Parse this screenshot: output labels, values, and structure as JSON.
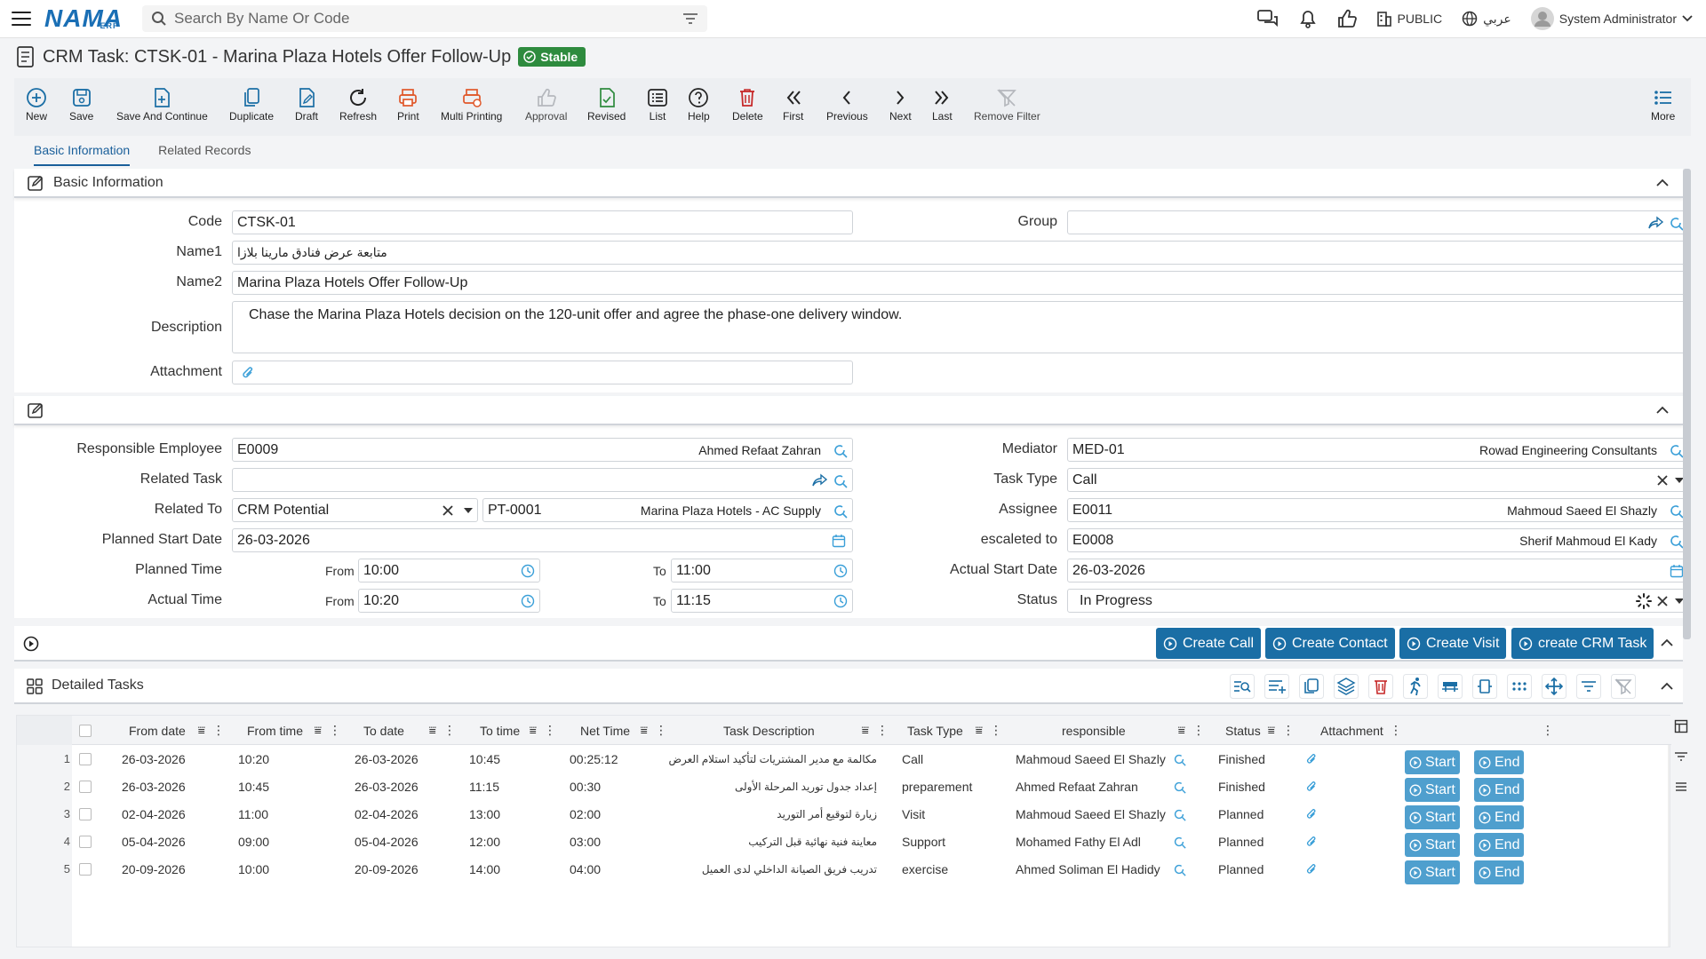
{
  "topbar": {
    "search_placeholder": "Search By Name Or Code",
    "public_label": "PUBLIC",
    "language_label": "عربي",
    "user_name": "System Administrator"
  },
  "logo": {
    "text": "NAMA",
    "sub": "ERP"
  },
  "page": {
    "title": "CRM Task: CTSK-01 - Marina Plaza Hotels Offer Follow-Up",
    "status_badge": "Stable"
  },
  "toolbar": {
    "new": "New",
    "save": "Save",
    "save_continue": "Save And Continue",
    "duplicate": "Duplicate",
    "draft": "Draft",
    "refresh": "Refresh",
    "print": "Print",
    "multi_printing": "Multi Printing",
    "approval": "Approval",
    "revised": "Revised",
    "list": "List",
    "help": "Help",
    "delete": "Delete",
    "first": "First",
    "previous": "Previous",
    "next": "Next",
    "last": "Last",
    "remove_filter": "Remove Filter",
    "more": "More"
  },
  "tabs": {
    "basic": "Basic Information",
    "related": "Related Records"
  },
  "basic_section": {
    "title": "Basic Information",
    "code_label": "Code",
    "code_value": "CTSK-01",
    "group_label": "Group",
    "group_value": "",
    "name1_label": "Name1",
    "name1_value": "متابعة عرض فنادق مارينا بلازا",
    "name2_label": "Name2",
    "name2_value": "Marina Plaza Hotels Offer Follow-Up",
    "description_label": "Description",
    "description_value": "Chase the Marina Plaza Hotels decision on the 120-unit offer and agree the phase-one delivery window.",
    "attachment_label": "Attachment"
  },
  "detail_section": {
    "responsible_label": "Responsible Employee",
    "responsible_code": "E0009",
    "responsible_name": "Ahmed Refaat Zahran",
    "related_task_label": "Related Task",
    "related_task_value": "",
    "related_to_label": "Related To",
    "related_to_value": "CRM Potential",
    "related_to_code": "PT-0001",
    "related_to_name": "Marina Plaza Hotels - AC Supply",
    "planned_start_label": "Planned Start Date",
    "planned_start_value": "26-03-2026",
    "planned_time_label": "Planned Time",
    "from_label": "From",
    "to_label": "To",
    "planned_from": "10:00",
    "planned_to": "11:00",
    "actual_time_label": "Actual Time",
    "actual_from": "10:20",
    "actual_to": "11:15",
    "mediator_label": "Mediator",
    "mediator_code": "MED-01",
    "mediator_name": "Rowad Engineering Consultants",
    "task_type_label": "Task Type",
    "task_type_value": "Call",
    "assignee_label": "Assignee",
    "assignee_code": "E0011",
    "assignee_name": "Mahmoud Saeed El Shazly",
    "escalated_label": "escaleted to",
    "escalated_code": "E0008",
    "escalated_name": "Sherif Mahmoud El Kady",
    "actual_start_label": "Actual Start Date",
    "actual_start_value": "26-03-2026",
    "status_label": "Status",
    "status_value": "In Progress"
  },
  "actions": {
    "create_call": "Create Call",
    "create_contact": "Create Contact",
    "create_visit": "Create Visit",
    "create_task": "create CRM Task"
  },
  "detailed_tasks": {
    "title": "Detailed Tasks",
    "columns": {
      "from_date": "From date",
      "from_time": "From time",
      "to_date": "To date",
      "to_time": "To time",
      "net_time": "Net Time",
      "desc": "Task Description",
      "type": "Task Type",
      "resp": "responsible",
      "status": "Status",
      "attach": "Attachment"
    },
    "start_label": "Start",
    "end_label": "End",
    "rows": [
      {
        "num": "1",
        "from_date": "26-03-2026",
        "from_time": "10:20",
        "to_date": "26-03-2026",
        "to_time": "10:45",
        "net": "00:25:12",
        "desc": "مكالمة مع مدير المشتريات لتأكيد استلام العرض",
        "type": "Call",
        "resp": "Mahmoud Saeed El Shazly",
        "status": "Finished"
      },
      {
        "num": "2",
        "from_date": "26-03-2026",
        "from_time": "10:45",
        "to_date": "26-03-2026",
        "to_time": "11:15",
        "net": "00:30",
        "desc": "إعداد جدول توريد المرحلة الأولى",
        "type": "preparement",
        "resp": "Ahmed Refaat Zahran",
        "status": "Finished"
      },
      {
        "num": "3",
        "from_date": "02-04-2026",
        "from_time": "11:00",
        "to_date": "02-04-2026",
        "to_time": "13:00",
        "net": "02:00",
        "desc": "زيارة لتوقيع أمر التوريد",
        "type": "Visit",
        "resp": "Mahmoud Saeed El Shazly",
        "status": "Planned"
      },
      {
        "num": "4",
        "from_date": "05-04-2026",
        "from_time": "09:00",
        "to_date": "05-04-2026",
        "to_time": "12:00",
        "net": "03:00",
        "desc": "معاينة فنية نهائية قبل التركيب",
        "type": "Support",
        "resp": "Mohamed Fathy El Adl",
        "status": "Planned"
      },
      {
        "num": "5",
        "from_date": "20-09-2026",
        "from_time": "10:00",
        "to_date": "20-09-2026",
        "to_time": "14:00",
        "net": "04:00",
        "desc": "تدريب فريق الصيانة الداخلي لدى العميل",
        "type": "exercise",
        "resp": "Ahmed Soliman El Hadidy",
        "status": "Planned"
      }
    ]
  },
  "colors": {
    "primary": "#1a6ea5",
    "stable": "#2e8b3e",
    "rowbtn": "#4f9fce"
  }
}
